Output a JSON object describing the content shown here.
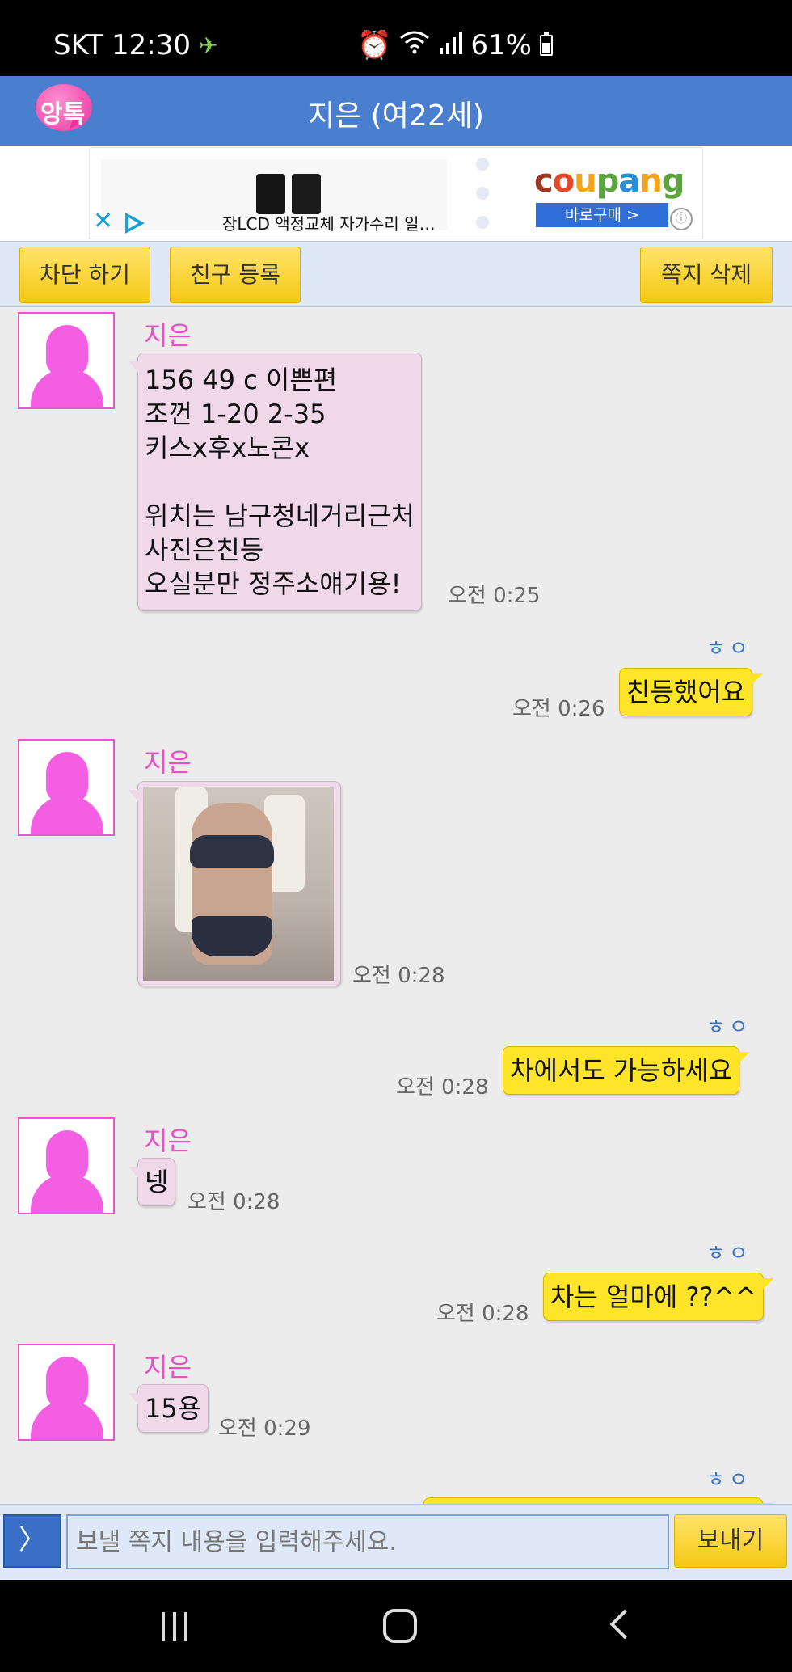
{
  "status_bar": {
    "carrier": "SKT",
    "time": "12:30",
    "battery": "61%"
  },
  "header": {
    "app_logo_text": "앙톡",
    "title": "지은 (여22세)"
  },
  "ad": {
    "text": "장LCD 액정교체 자가수리 일…",
    "brand": "coupang",
    "buy_label": "바로구매 >"
  },
  "actions": {
    "block_label": "차단 하기",
    "friend_label": "친구 등록",
    "delete_label": "쪽지 삭제"
  },
  "messages": [
    {
      "sender": "지은",
      "text": "156 49 c 이쁜편\n조껀 1-20 2-35\n키스x후x노콘x\n\n위치는 남구청네거리근처\n사진은친등\n오실분만 정주소얘기용!",
      "time": "오전 0:25"
    },
    {
      "read": "ㅎㅇ",
      "text": "친등했어요",
      "time": "오전 0:26"
    },
    {
      "sender": "지은",
      "time": "오전 0:28"
    },
    {
      "read": "ㅎㅇ",
      "text": "차에서도 가능하세요",
      "time": "오전 0:28"
    },
    {
      "sender": "지은",
      "text": "넹",
      "time": "오전 0:28"
    },
    {
      "read": "ㅎㅇ",
      "text": "차는 얼마에 ??^^",
      "time": "오전 0:28"
    },
    {
      "sender": "지은",
      "text": "15용",
      "time": "오전 0:29"
    },
    {
      "read": "ㅎㅇ"
    }
  ],
  "input": {
    "menu_label": "〉",
    "placeholder": "보낼 쪽지 내용을 입력해주세요.",
    "send_label": "보내기"
  }
}
